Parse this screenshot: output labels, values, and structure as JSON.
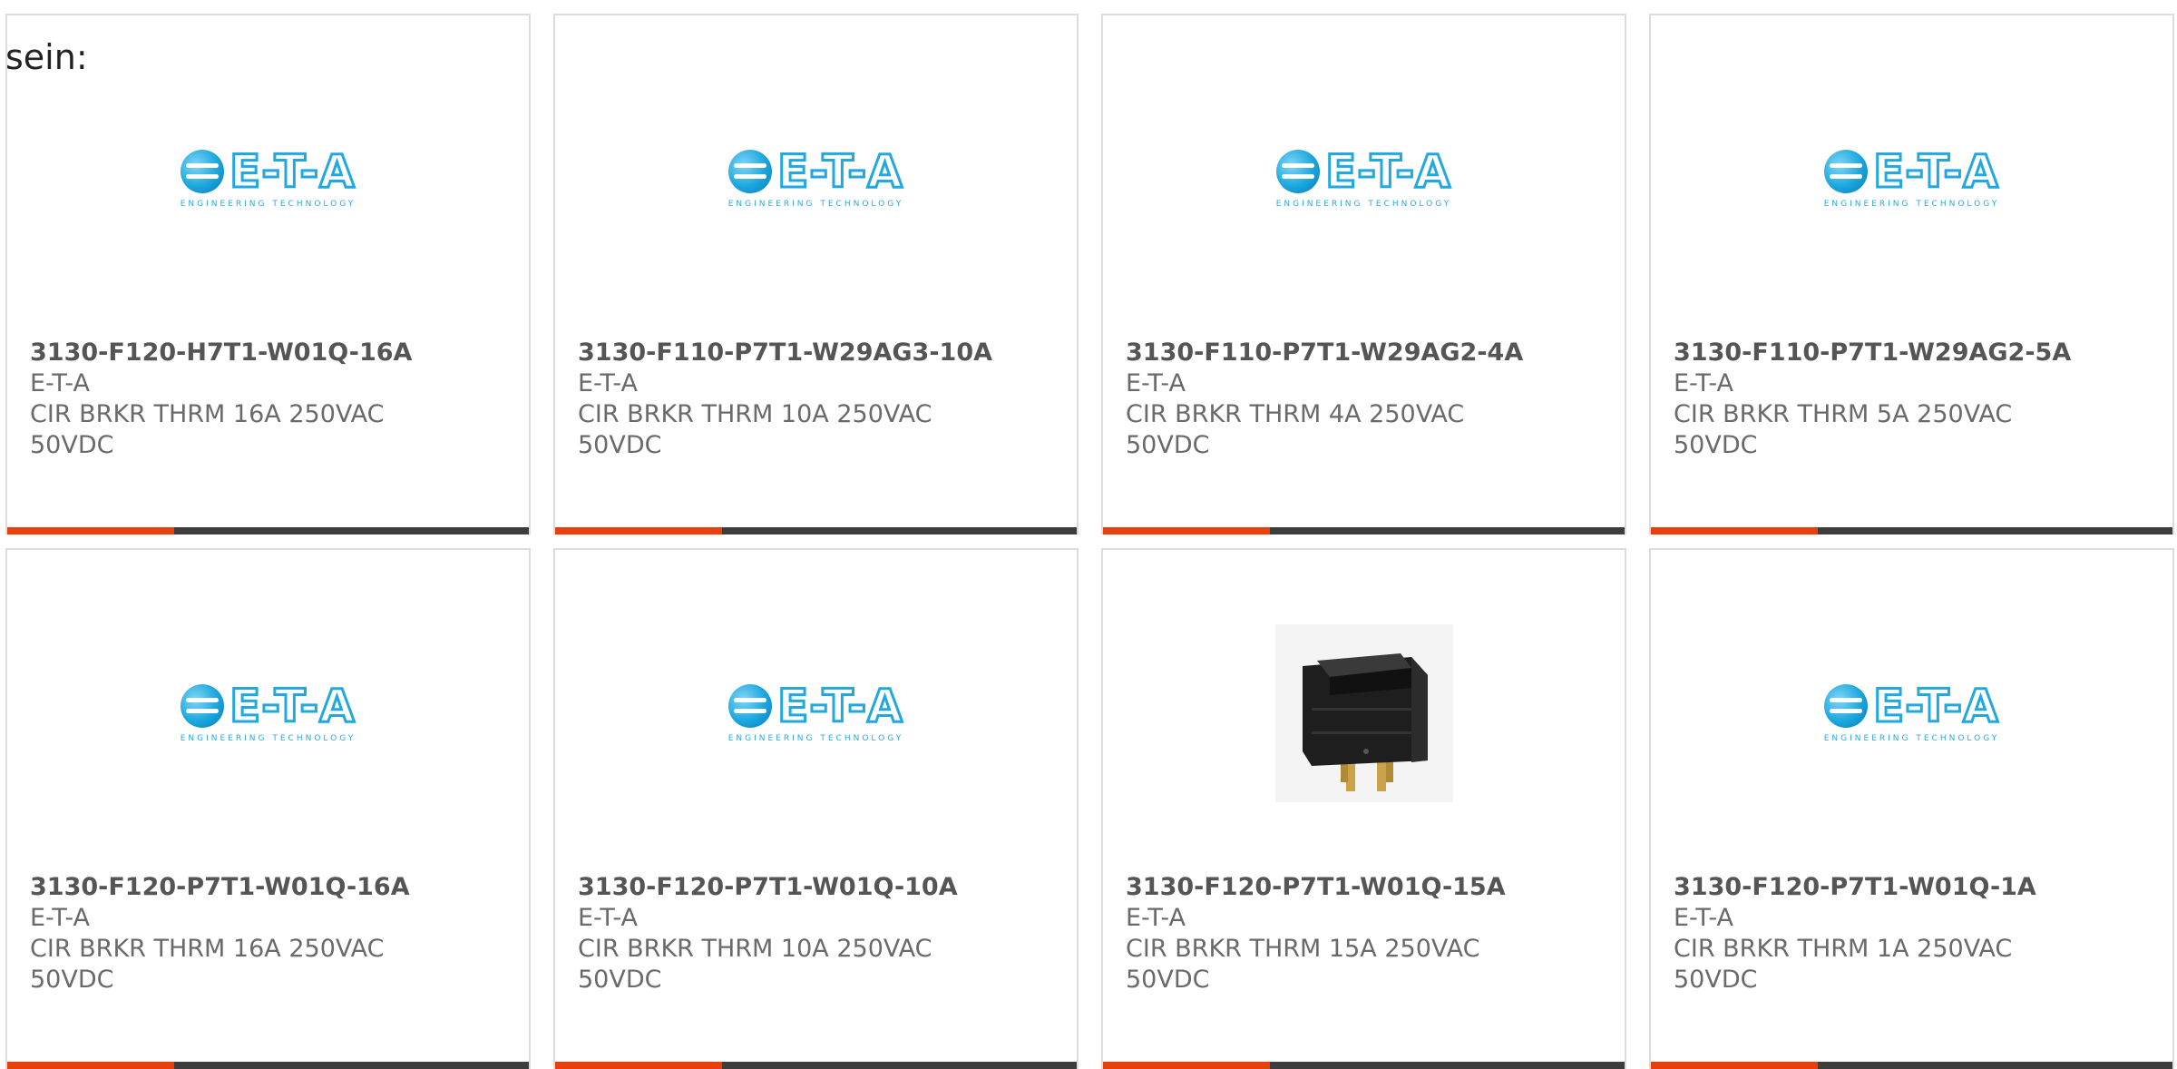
{
  "intro_text": "sein:",
  "colors": {
    "accent": "#e8400c",
    "bar": "#3d3d3d",
    "logo_blue": "#22a8e0"
  },
  "logo": {
    "text": "E-T-A",
    "subtitle": "ENGINEERING TECHNOLOGY"
  },
  "products": [
    {
      "part_number": "3130-F120-H7T1-W01Q-16A",
      "manufacturer": "E-T-A",
      "description": "CIR BRKR THRM 16A 250VAC 50VDC",
      "image": "eta-logo"
    },
    {
      "part_number": "3130-F110-P7T1-W29AG3-10A",
      "manufacturer": "E-T-A",
      "description": "CIR BRKR THRM 10A 250VAC 50VDC",
      "image": "eta-logo"
    },
    {
      "part_number": "3130-F110-P7T1-W29AG2-4A",
      "manufacturer": "E-T-A",
      "description": "CIR BRKR THRM 4A 250VAC 50VDC",
      "image": "eta-logo"
    },
    {
      "part_number": "3130-F110-P7T1-W29AG2-5A",
      "manufacturer": "E-T-A",
      "description": "CIR BRKR THRM 5A 250VAC 50VDC",
      "image": "eta-logo"
    },
    {
      "part_number": "3130-F120-P7T1-W01Q-16A",
      "manufacturer": "E-T-A",
      "description": "CIR BRKR THRM 16A 250VAC 50VDC",
      "image": "eta-logo"
    },
    {
      "part_number": "3130-F120-P7T1-W01Q-10A",
      "manufacturer": "E-T-A",
      "description": "CIR BRKR THRM 10A 250VAC 50VDC",
      "image": "eta-logo"
    },
    {
      "part_number": "3130-F120-P7T1-W01Q-15A",
      "manufacturer": "E-T-A",
      "description": "CIR BRKR THRM 15A 250VAC 50VDC",
      "image": "rocker-switch-photo"
    },
    {
      "part_number": "3130-F120-P7T1-W01Q-1A",
      "manufacturer": "E-T-A",
      "description": "CIR BRKR THRM 1A 250VAC 50VDC",
      "image": "eta-logo"
    }
  ]
}
